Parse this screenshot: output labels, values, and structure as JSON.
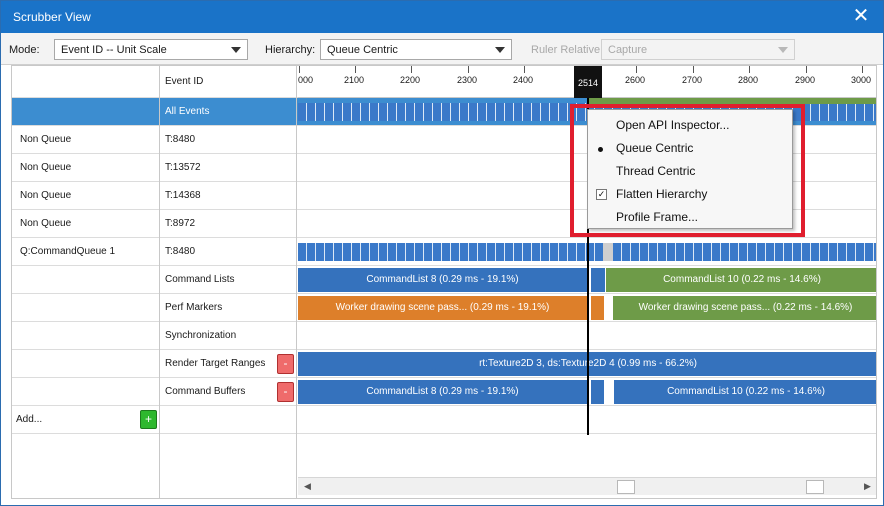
{
  "window": {
    "title": "Scrubber View",
    "close_glyph": "✕"
  },
  "toolbar": {
    "mode_label": "Mode:",
    "mode_value": "Event ID -- Unit Scale",
    "hierarchy_label": "Hierarchy:",
    "hierarchy_value": "Queue Centric",
    "ruler_label": "Ruler Relative:",
    "ruler_value": "Capture"
  },
  "header": {
    "col2": "Event ID"
  },
  "ruler": {
    "ticks": [
      "000",
      "2100",
      "2200",
      "2300",
      "2400",
      "2600",
      "2700",
      "2800",
      "2900",
      "3000"
    ],
    "current": "2514"
  },
  "rows": [
    {
      "c1": "",
      "c2": "All Events"
    },
    {
      "c1": "Non Queue",
      "c2": "T:8480"
    },
    {
      "c1": "Non Queue",
      "c2": "T:13572"
    },
    {
      "c1": "Non Queue",
      "c2": "T:14368"
    },
    {
      "c1": "Non Queue",
      "c2": "T:8972"
    },
    {
      "c1": "Q:CommandQueue 1",
      "c2": "T:8480"
    },
    {
      "c1": "",
      "c2": "Command Lists"
    },
    {
      "c1": "",
      "c2": "Perf Markers"
    },
    {
      "c1": "",
      "c2": "Synchronization"
    },
    {
      "c1": "",
      "c2": "Render Target Ranges"
    },
    {
      "c1": "",
      "c2": "Command Buffers"
    },
    {
      "c1": "Add...",
      "c2": ""
    }
  ],
  "buttons": {
    "remove": "-",
    "add": "+"
  },
  "bars": {
    "cmdlist_a": "CommandList 8 (0.29 ms - 19.1%)",
    "cmdlist_b": "CommandList 10 (0.22 ms - 14.6%)",
    "perf_a": "Worker drawing scene pass... (0.29 ms - 19.1%)",
    "perf_b": "Worker drawing scene pass... (0.22 ms - 14.6%)",
    "rt": "rt:Texture2D 3, ds:Texture2D 4 (0.99 ms - 66.2%)",
    "cmdbuf_a": "CommandList 8 (0.29 ms - 19.1%)",
    "cmdbuf_b": "CommandList 10 (0.22 ms - 14.6%)"
  },
  "context_menu": {
    "items": [
      "Open API Inspector...",
      "Queue Centric",
      "Thread Centric",
      "Flatten Hierarchy",
      "Profile Frame..."
    ]
  },
  "scroll": {
    "left": "◀",
    "right": "▶"
  },
  "colors": {
    "title_bar": "#1a73c8",
    "selection": "#3c8dd0",
    "bar_blue": "#3572bd",
    "bar_orange": "#dd7f2a",
    "bar_green": "#6e9b48",
    "highlight": "#e01e2e"
  }
}
